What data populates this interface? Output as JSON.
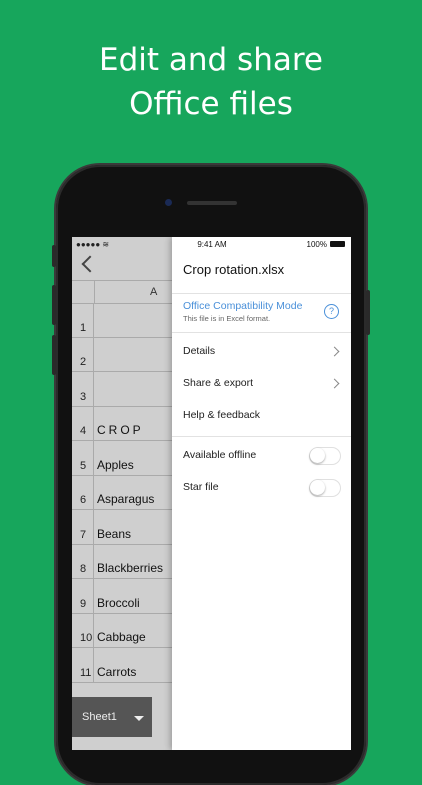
{
  "headline": {
    "line1": "Edit and share",
    "line2": "Office files"
  },
  "sheet": {
    "status_left": "●●●●● ≋",
    "column_header": "A",
    "rows": [
      {
        "num": "1",
        "value": ""
      },
      {
        "num": "2",
        "value": ""
      },
      {
        "num": "3",
        "value": ""
      },
      {
        "num": "4",
        "value": "CROP"
      },
      {
        "num": "5",
        "value": "Apples"
      },
      {
        "num": "6",
        "value": "Asparagus"
      },
      {
        "num": "7",
        "value": "Beans"
      },
      {
        "num": "8",
        "value": "Blackberries"
      },
      {
        "num": "9",
        "value": "Broccoli"
      },
      {
        "num": "10",
        "value": "Cabbage"
      },
      {
        "num": "11",
        "value": "Carrots"
      }
    ],
    "tab_label": "Sheet1"
  },
  "panel": {
    "time": "9:41 AM",
    "battery": "100%",
    "file_title": "Crop rotation.xlsx",
    "compat_title": "Office Compatibility Mode",
    "compat_subtitle": "This file is in Excel format.",
    "help_glyph": "?",
    "menu": {
      "details": "Details",
      "share": "Share & export",
      "help": "Help & feedback",
      "offline": "Available offline",
      "star": "Star file"
    },
    "toggles": {
      "offline": false,
      "star": false
    }
  },
  "colors": {
    "background": "#17a65c",
    "accent": "#4a90d9"
  }
}
